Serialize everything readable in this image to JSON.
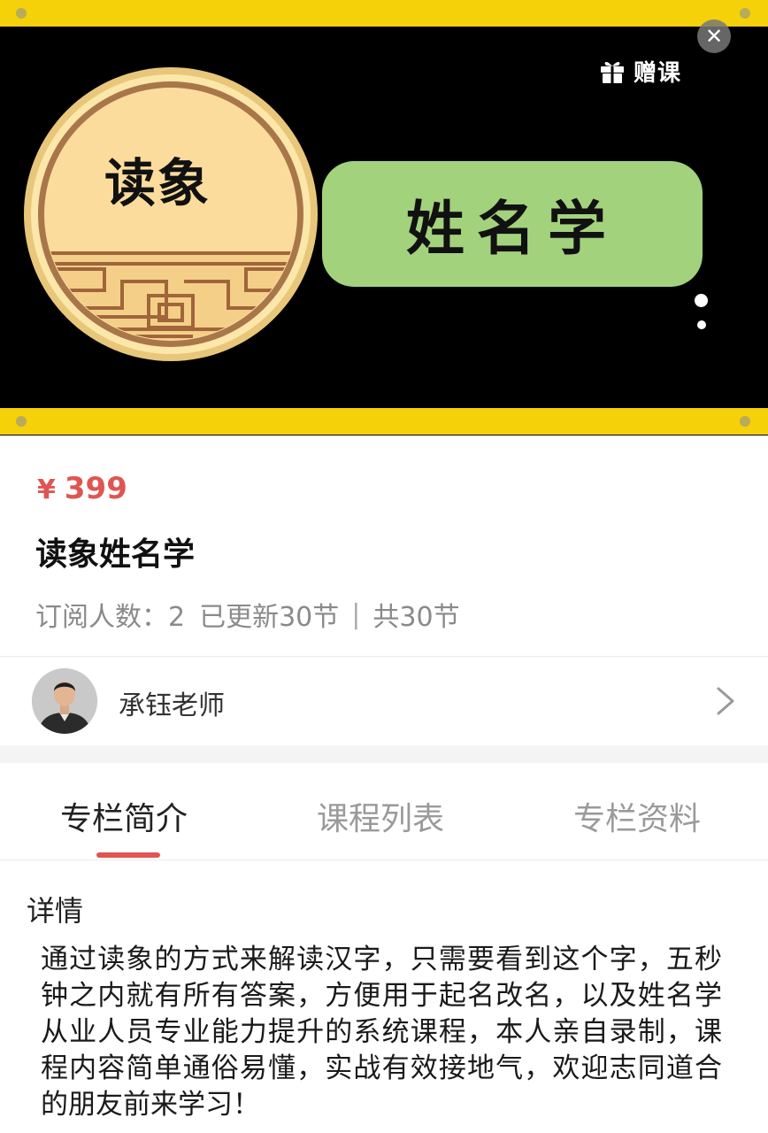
{
  "banner": {
    "close_symbol": "✕",
    "gift_icon": "gift-icon",
    "gift_label": "赠课",
    "medal_text": "读象",
    "pill_text": "姓名学",
    "colors": {
      "rail": "#f5d10a",
      "background": "#000000",
      "pill": "#a3d27c",
      "medal_face": "#fbdc9c"
    }
  },
  "course": {
    "price_symbol": "¥",
    "price": "399",
    "title": "读象姓名学",
    "subscribers": "订阅人数：2",
    "updated": "已更新30节",
    "separator": "|",
    "total": "共30节"
  },
  "teacher": {
    "name": "承钰老师",
    "avatar_icon": "avatar-icon",
    "chevron_icon": "chevron-right-icon"
  },
  "tabs": [
    {
      "label": "专栏简介",
      "active": true
    },
    {
      "label": "课程列表",
      "active": false
    },
    {
      "label": "专栏资料",
      "active": false
    }
  ],
  "detail": {
    "heading": "详情",
    "body": "通过读象的方式来解读汉字，只需要看到这个字，五秒钟之内就有所有答案，方便用于起名改名，以及姓名学从业人员专业能力提升的系统课程，本人亲自录制，课程内容简单通俗易懂，实战有效接地气，欢迎志同道合的朋友前来学习！"
  },
  "accent_color": "#e05552"
}
